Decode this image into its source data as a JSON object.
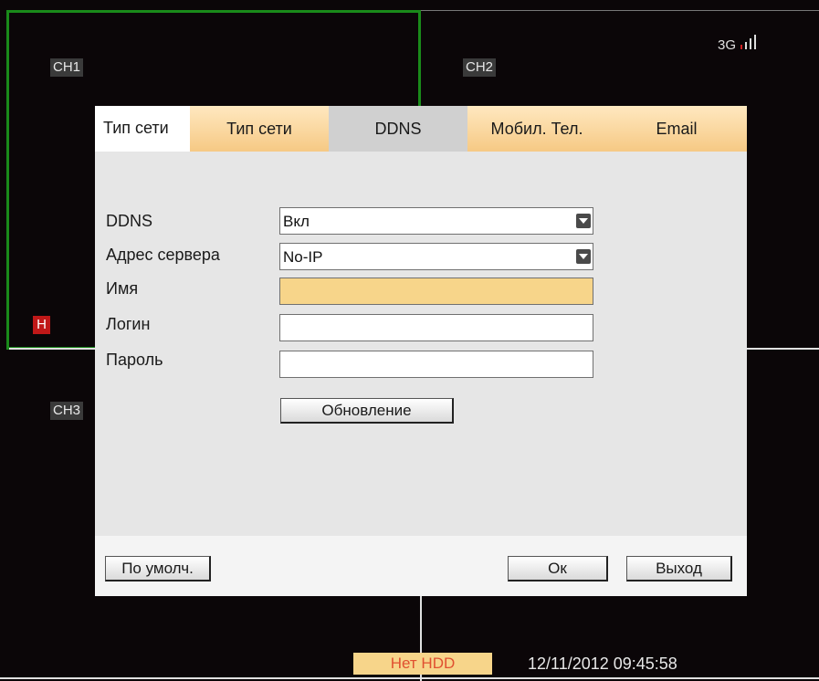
{
  "channels": {
    "ch1": "CH1",
    "ch2": "CH2",
    "ch3": "CH3"
  },
  "rec_indicator": "H",
  "signal": {
    "label": "3G",
    "icon": "signal-bars-icon"
  },
  "dialog": {
    "title_tab": "Тип сети",
    "tabs": [
      {
        "label": "Тип сети",
        "state": "inactive"
      },
      {
        "label": "DDNS",
        "state": "active"
      },
      {
        "label": "Мобил. Тел.",
        "state": "inactive"
      },
      {
        "label": "Email",
        "state": "inactive"
      }
    ],
    "fields": {
      "ddns": {
        "label": "DDNS",
        "value": "Вкл"
      },
      "server": {
        "label": "Адрес сервера",
        "value": "No-IP"
      },
      "name": {
        "label": "Имя",
        "value": ""
      },
      "login": {
        "label": "Логин",
        "value": ""
      },
      "password": {
        "label": "Пароль",
        "value": ""
      }
    },
    "update_button": "Обновление",
    "footer": {
      "default_button": "По умолч.",
      "ok_button": "Ок",
      "exit_button": "Выход"
    }
  },
  "status": {
    "hdd": "Нет HDD",
    "datetime": "12/11/2012 09:45:58"
  },
  "colors": {
    "highlight": "#f7d58a",
    "tab_orange": "#f6c984",
    "active_tab": "#d0d0d0",
    "selected_border": "#1a8a1a"
  }
}
